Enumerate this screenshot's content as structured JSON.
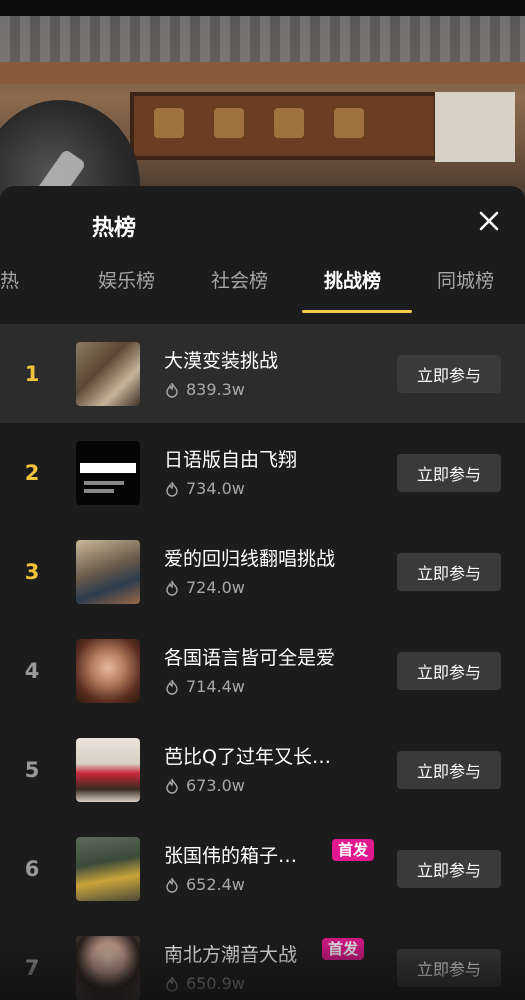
{
  "panel": {
    "title": "热榜",
    "close_icon": "close-icon",
    "tabs": [
      {
        "label": "娱乐榜",
        "active": false
      },
      {
        "label": "社会榜",
        "active": false
      },
      {
        "label": "挑战榜",
        "active": true
      },
      {
        "label": "同城榜",
        "active": false
      }
    ],
    "partial_tab_label": "热"
  },
  "colors": {
    "accent": "#f2c94c",
    "top_rank": "#f2c23b",
    "badge": "#e3198f",
    "panel_bg": "#1c1c1c",
    "button_bg": "#3a3a3a"
  },
  "items": [
    {
      "rank": "1",
      "title": "大漠变装挑战",
      "count": "839.3w",
      "button": "立即参与",
      "badge": ""
    },
    {
      "rank": "2",
      "title": "日语版自由飞翔",
      "count": "734.0w",
      "button": "立即参与",
      "badge": ""
    },
    {
      "rank": "3",
      "title": "爱的回归线翻唱挑战",
      "count": "724.0w",
      "button": "立即参与",
      "badge": ""
    },
    {
      "rank": "4",
      "title": "各国语言皆可全是爱",
      "count": "714.4w",
      "button": "立即参与",
      "badge": ""
    },
    {
      "rank": "5",
      "title": "芭比Q了过年又长…",
      "count": "673.0w",
      "button": "立即参与",
      "badge": ""
    },
    {
      "rank": "6",
      "title": "张国伟的箱子…",
      "count": "652.4w",
      "button": "立即参与",
      "badge": "首发"
    },
    {
      "rank": "7",
      "title": "南北方潮音大战",
      "count": "650.9w",
      "button": "立即参与",
      "badge": "首发"
    }
  ]
}
